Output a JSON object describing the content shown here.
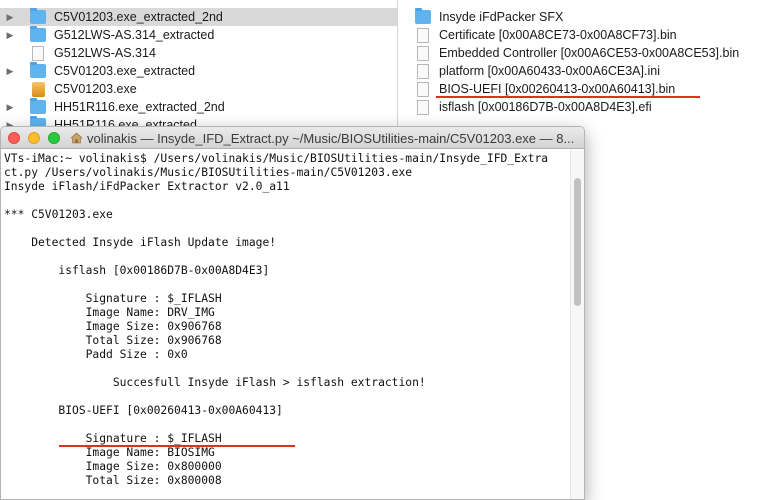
{
  "finder": {
    "left_items": [
      {
        "label": "C5V01203.exe_extracted_2nd",
        "type": "folder",
        "disclosure": "▶",
        "selected": true
      },
      {
        "label": "G512LWS-AS.314_extracted",
        "type": "folder",
        "disclosure": "▶",
        "selected": false
      },
      {
        "label": "G512LWS-AS.314",
        "type": "file",
        "disclosure": "",
        "selected": false
      },
      {
        "label": "C5V01203.exe_extracted",
        "type": "folder",
        "disclosure": "▶",
        "selected": false
      },
      {
        "label": "C5V01203.exe",
        "type": "exe",
        "disclosure": "",
        "selected": false
      },
      {
        "label": "HH51R116.exe_extracted_2nd",
        "type": "folder",
        "disclosure": "▶",
        "selected": false
      },
      {
        "label": "HH51R116.exe_extracted",
        "type": "folder",
        "disclosure": "▶",
        "selected": false
      }
    ],
    "right_items": [
      {
        "label": "Insyde iFdPacker SFX",
        "type": "folder"
      },
      {
        "label": "Certificate [0x00A8CE73-0x00A8CF73].bin",
        "type": "file"
      },
      {
        "label": "Embedded Controller [0x00A6CE53-0x00A8CE53].bin",
        "type": "file"
      },
      {
        "label": "platform [0x00A60433-0x00A6CE3A].ini",
        "type": "file"
      },
      {
        "label": "BIOS-UEFI [0x00260413-0x00A60413].bin",
        "type": "file"
      },
      {
        "label": "isflash [0x00186D7B-0x00A8D4E3].efi",
        "type": "file"
      }
    ]
  },
  "terminal": {
    "title": "volinakis — Insyde_IFD_Extract.py ~/Music/BIOSUtilities-main/C5V01203.exe — 8...",
    "lines": [
      "VTs-iMac:~ volinakis$ /Users/volinakis/Music/BIOSUtilities-main/Insyde_IFD_Extra",
      "ct.py /Users/volinakis/Music/BIOSUtilities-main/C5V01203.exe",
      "Insyde iFlash/iFdPacker Extractor v2.0_a11",
      "",
      "*** C5V01203.exe",
      "",
      "    Detected Insyde iFlash Update image!",
      "",
      "        isflash [0x00186D7B-0x00A8D4E3]",
      "",
      "            Signature : $_IFLASH",
      "            Image Name: DRV_IMG",
      "            Image Size: 0x906768",
      "            Total Size: 0x906768",
      "            Padd Size : 0x0",
      "",
      "                Succesfull Insyde iFlash > isflash extraction!",
      "",
      "        BIOS-UEFI [0x00260413-0x00A60413]",
      "",
      "            Signature : $_IFLASH",
      "            Image Name: BIOSIMG",
      "            Image Size: 0x800000",
      "            Total Size: 0x800008"
    ]
  },
  "colors": {
    "annotation_red": "#e0301e",
    "folder_blue": "#5fb3ee",
    "selected_row": "#d9d9d9"
  }
}
